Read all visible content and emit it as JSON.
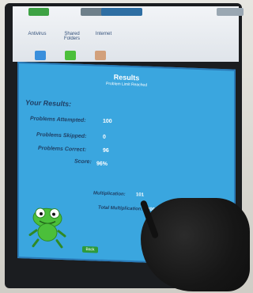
{
  "desktop_icons": [
    {
      "label": "Antivirus",
      "color": "#7fb3e6"
    },
    {
      "label": "Shared Folders",
      "color": "#6fa0d8"
    },
    {
      "label": "Internet",
      "color": "#5fb2f0"
    }
  ],
  "results": {
    "title": "Results",
    "subtitle": "Problem Limit Reached",
    "your_results": "Your Results:",
    "rows": [
      {
        "label": "Problems Attempted:",
        "value": "100"
      },
      {
        "label": "Problems Skipped:",
        "value": "0"
      },
      {
        "label": "Problems Correct:",
        "value": "96"
      },
      {
        "label": "Score:",
        "value": "96%"
      }
    ],
    "lower_rows": [
      {
        "label": "Multiplication:",
        "value": "101"
      },
      {
        "label": "Total Multiplication:",
        "value": "200"
      }
    ],
    "back_label": "Back"
  },
  "colors": {
    "panel_bg": "#3aa6df",
    "panel_border": "#2a79b6",
    "label_text": "#1f3f64",
    "value_text": "#ffffff",
    "frog_green": "#4bbf3a",
    "back_button": "#2d9a3a"
  }
}
